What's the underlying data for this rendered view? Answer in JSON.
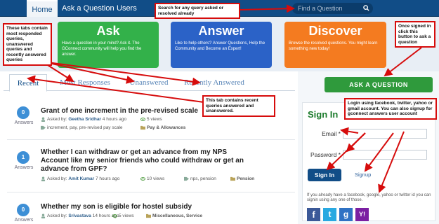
{
  "nav": {
    "home": "Home",
    "ask": "Ask a Question",
    "users": "Users",
    "search_placeholder": "Find a Question",
    "icons": {
      "search": "search-icon"
    }
  },
  "hero": {
    "ask": {
      "title": "Ask",
      "desc": "Have a question in your mind? Ask it. The GConnect community will help you find the answer.",
      "color": "#33b14a"
    },
    "answer": {
      "title": "Answer",
      "desc": "Like to help others? Answer Questions, Help the Community and Become an Expert!",
      "color": "#2b62c7"
    },
    "discover": {
      "title": "Discover",
      "desc": "Browse the resolved questions. You might learn something new today!",
      "color": "#f47b20"
    }
  },
  "tabs": [
    "Recent",
    "Most Responses",
    "Unanswered",
    "Recently Answered"
  ],
  "questions": [
    {
      "answers": "0",
      "answers_label": "Answers",
      "title": "Grant of one increment in the pre-revised scale",
      "asked_by_label": "Asked by:",
      "author": "Geetha Sridhar",
      "time": "4 hours ago",
      "views": "5 views",
      "tags": "increment, pay, pre-revised pay scale",
      "category": "Pay & Allowances"
    },
    {
      "answers": "1",
      "answers_label": "Answers",
      "title": "Whether I can withdraw or get an advance from my NPS Account like my senior friends who could withdraw or get an advance from GPF?",
      "asked_by_label": "Asked by:",
      "author": "Amit Kumar",
      "time": "7 hours ago",
      "views": "10 views",
      "tags": "nps, pension",
      "category": "Pension"
    },
    {
      "answers": "0",
      "answers_label": "Answers",
      "title": "Whether my son is eligible for hostel subsidy",
      "asked_by_label": "Asked by:",
      "author": "Srivastava",
      "time": "14 hours ago",
      "views": "5 views",
      "tags": "",
      "category": "Miscellaneous, Service"
    }
  ],
  "sidebar": {
    "ask_button": "ASK A QUESTION",
    "signin_title": "Sign In",
    "email_label": "Email *",
    "password_label": "Password *",
    "signin_button": "Sign In",
    "signup_link": "Signup",
    "social_text": "If you already have a facebook, google, yahoo or twitter id you can signin using any one of those.",
    "social": [
      {
        "glyph": "f",
        "color": "#3b5998"
      },
      {
        "glyph": "t",
        "color": "#29a9e1"
      },
      {
        "glyph": "g",
        "color": "#2f72c4"
      },
      {
        "glyph": "Y!",
        "color": "#7b1fa2"
      }
    ]
  },
  "annotations": {
    "search": "Search for any query asked or resolved already",
    "ask_button": "Once signed in click this button to ask a question",
    "tabs": "These tabs contain most responded queries, unanswered queries and recently answered queries",
    "recent_tab": "This tab contains recent queries answered and unanswered.",
    "login": "Login using facebook, twitter, yahoo or gmail account. You can also signup for gconnect answers user account"
  }
}
